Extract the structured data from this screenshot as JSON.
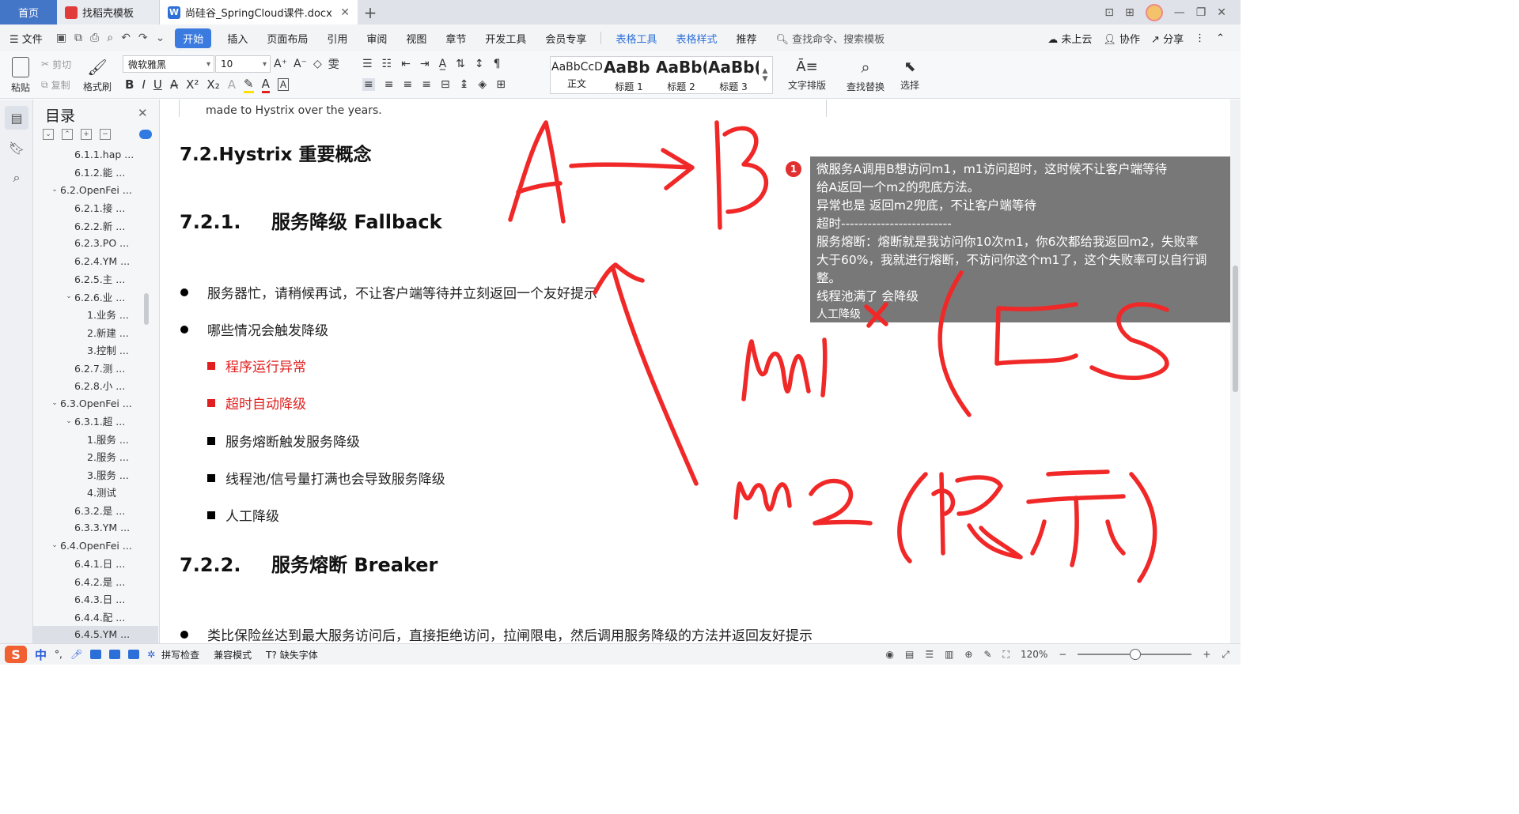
{
  "tabs": {
    "home": "首页",
    "template": "找稻壳模板",
    "doc": "尚硅谷_SpringCloud课件.docx"
  },
  "menu": {
    "file": "文件",
    "items": [
      "开始",
      "插入",
      "页面布局",
      "引用",
      "审阅",
      "视图",
      "章节",
      "开发工具",
      "会员专享",
      "表格工具",
      "表格样式",
      "推荐"
    ],
    "search": "查找命令、搜索模板",
    "cloud": "未上云",
    "collab": "协作",
    "share": "分享"
  },
  "ribbon": {
    "paste": "粘贴",
    "cut": "剪切",
    "copy": "复制",
    "format_painter": "格式刷",
    "font_name": "微软雅黑",
    "font_size": "10",
    "styles": [
      {
        "sample": "AaBbCcDd",
        "name": "正文"
      },
      {
        "sample": "AaBb",
        "name": "标题 1"
      },
      {
        "sample": "AaBb(",
        "name": "标题 2"
      },
      {
        "sample": "AaBb(",
        "name": "标题 3"
      }
    ],
    "text_layout": "文字排版",
    "find_replace": "查找替换",
    "select": "选择"
  },
  "nav": {
    "title": "目录",
    "items": [
      {
        "label": "6.1.1.hap ...",
        "level": 3,
        "arrow": ""
      },
      {
        "label": "6.1.2.能 ...",
        "level": 3,
        "arrow": ""
      },
      {
        "label": "6.2.OpenFei ...",
        "level": 2,
        "arrow": "v"
      },
      {
        "label": "6.2.1.接 ...",
        "level": 3,
        "arrow": ""
      },
      {
        "label": "6.2.2.新 ...",
        "level": 3,
        "arrow": ""
      },
      {
        "label": "6.2.3.PO ...",
        "level": 3,
        "arrow": ""
      },
      {
        "label": "6.2.4.YM ...",
        "level": 3,
        "arrow": ""
      },
      {
        "label": "6.2.5.主 ...",
        "level": 3,
        "arrow": ""
      },
      {
        "label": "6.2.6.业 ...",
        "level": 3,
        "arrow": "v"
      },
      {
        "label": "1.业务 ...",
        "level": 4,
        "arrow": ""
      },
      {
        "label": "2.新建 ...",
        "level": 4,
        "arrow": ""
      },
      {
        "label": "3.控制 ...",
        "level": 4,
        "arrow": ""
      },
      {
        "label": "6.2.7.测 ...",
        "level": 3,
        "arrow": ""
      },
      {
        "label": "6.2.8.小 ...",
        "level": 3,
        "arrow": ""
      },
      {
        "label": "6.3.OpenFei ...",
        "level": 2,
        "arrow": "v"
      },
      {
        "label": "6.3.1.超 ...",
        "level": 3,
        "arrow": "v"
      },
      {
        "label": "1.服务 ...",
        "level": 4,
        "arrow": ""
      },
      {
        "label": "2.服务 ...",
        "level": 4,
        "arrow": ""
      },
      {
        "label": "3.服务 ...",
        "level": 4,
        "arrow": ""
      },
      {
        "label": "4.测试",
        "level": 4,
        "arrow": ""
      },
      {
        "label": "6.3.2.是 ...",
        "level": 3,
        "arrow": ""
      },
      {
        "label": "6.3.3.YM ...",
        "level": 3,
        "arrow": ""
      },
      {
        "label": "6.4.OpenFei ...",
        "level": 2,
        "arrow": "v"
      },
      {
        "label": "6.4.1.日 ...",
        "level": 3,
        "arrow": ""
      },
      {
        "label": "6.4.2.是 ...",
        "level": 3,
        "arrow": ""
      },
      {
        "label": "6.4.3.日 ...",
        "level": 3,
        "arrow": ""
      },
      {
        "label": "6.4.4.配 ...",
        "level": 3,
        "arrow": ""
      },
      {
        "label": "6.4.5.YM ...",
        "level": 3,
        "arrow": "",
        "selected": true
      }
    ]
  },
  "doc": {
    "top_line": "made to Hystrix over the years.",
    "h2": "7.2.Hystrix 重要概念",
    "h3_1_num": "7.2.1.",
    "h3_1_text": "服务降级 Fallback",
    "b1": "服务器忙，请稍候再试，不让客户端等待并立刻返回一个友好提示",
    "b2": "哪些情况会触发降级",
    "s1": "程序运行异常",
    "s2": "超时自动降级",
    "s3": "服务熔断触发服务降级",
    "s4": "线程池/信号量打满也会导致服务降级",
    "s5": "人工降级",
    "h3_2_num": "7.2.2.",
    "h3_2_text": "服务熔断 Breaker",
    "b3": "类比保险丝达到最大服务访问后，直接拒绝访问，拉闸限电，然后调用服务降级的方法并返回友好提示"
  },
  "comment": {
    "badge": "1",
    "lines": [
      "微服务A调用B想访问m1，m1访问超时，这时候不让客户端等待",
      "给A返回一个m2的兜底方法。",
      "异常也是 返回m2兜底，不让客户端等待",
      "超时-------------------------",
      "服务熔断：熔断就是我访问你10次m1，你6次都给我返回m2，失败率",
      "大于60%，我就进行熔断，不访问你这个m1了，这个失败率可以自行调",
      "整。",
      "线程池满了 会降级",
      "人工降级"
    ]
  },
  "status": {
    "ime_char": "中",
    "spell": "拼写检查",
    "compat": "兼容模式",
    "missing_font": "缺失字体",
    "zoom": "120%"
  },
  "colors": {
    "accent": "#3b7be0",
    "ink": "#f02828",
    "comment_bg": "#6e6e6e"
  }
}
